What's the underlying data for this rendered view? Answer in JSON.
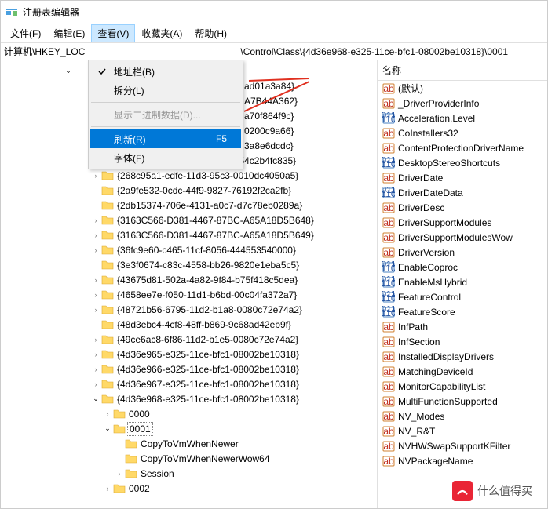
{
  "window": {
    "title": "注册表编辑器"
  },
  "menubar": {
    "file": "文件(F)",
    "edit": "编辑(E)",
    "view": "查看(V)",
    "fav": "收藏夹(A)",
    "help": "帮助(H)"
  },
  "addressbar": {
    "left": "计算机\\HKEY_LOC",
    "right": "\\Control\\Class\\{4d36e968-e325-11ce-bfc1-08002be10318}\\0001"
  },
  "dropdown": {
    "addr": "地址栏(B)",
    "split": "拆分(L)",
    "binary": "显示二进制数据(D)...",
    "refresh": "刷新(R)",
    "refresh_sc": "F5",
    "font": "字体(F)"
  },
  "tree": {
    "middle_peek": [
      "ad01a3a84}",
      "A7B44A362}",
      "a70f864f9c}",
      "0200c9a66}",
      "3a8e6dcdc}"
    ],
    "nodes": [
      {
        "t": "{25dbce51-6c8f-4a72-8a6d-b54c2b4fc835}",
        "ind": 115,
        "arrow": ">"
      },
      {
        "t": "{268c95a1-edfe-11d3-95c3-0010dc4050a5}",
        "ind": 115,
        "arrow": ">"
      },
      {
        "t": "{2a9fe532-0cdc-44f9-9827-76192f2ca2fb}",
        "ind": 115,
        "arrow": ""
      },
      {
        "t": "{2db15374-706e-4131-a0c7-d7c78eb0289a}",
        "ind": 115,
        "arrow": ""
      },
      {
        "t": "{3163C566-D381-4467-87BC-A65A18D5B648}",
        "ind": 115,
        "arrow": ">"
      },
      {
        "t": "{3163C566-D381-4467-87BC-A65A18D5B649}",
        "ind": 115,
        "arrow": ">"
      },
      {
        "t": "{36fc9e60-c465-11cf-8056-444553540000}",
        "ind": 115,
        "arrow": ">"
      },
      {
        "t": "{3e3f0674-c83c-4558-bb26-9820e1eba5c5}",
        "ind": 115,
        "arrow": ""
      },
      {
        "t": "{43675d81-502a-4a82-9f84-b75f418c5dea}",
        "ind": 115,
        "arrow": ">"
      },
      {
        "t": "{4658ee7e-f050-11d1-b6bd-00c04fa372a7}",
        "ind": 115,
        "arrow": ">"
      },
      {
        "t": "{48721b56-6795-11d2-b1a8-0080c72e74a2}",
        "ind": 115,
        "arrow": ">"
      },
      {
        "t": "{48d3ebc4-4cf8-48ff-b869-9c68ad42eb9f}",
        "ind": 115,
        "arrow": ""
      },
      {
        "t": "{49ce6ac8-6f86-11d2-b1e5-0080c72e74a2}",
        "ind": 115,
        "arrow": ">"
      },
      {
        "t": "{4d36e965-e325-11ce-bfc1-08002be10318}",
        "ind": 115,
        "arrow": ">"
      },
      {
        "t": "{4d36e966-e325-11ce-bfc1-08002be10318}",
        "ind": 115,
        "arrow": ">"
      },
      {
        "t": "{4d36e967-e325-11ce-bfc1-08002be10318}",
        "ind": 115,
        "arrow": ">"
      },
      {
        "t": "{4d36e968-e325-11ce-bfc1-08002be10318}",
        "ind": 115,
        "arrow": "v"
      },
      {
        "t": "0000",
        "ind": 130,
        "arrow": ">"
      },
      {
        "t": "0001",
        "ind": 130,
        "arrow": "v",
        "sel": true
      },
      {
        "t": "CopyToVmWhenNewer",
        "ind": 145,
        "arrow": ""
      },
      {
        "t": "CopyToVmWhenNewerWow64",
        "ind": 145,
        "arrow": ""
      },
      {
        "t": "Session",
        "ind": 145,
        "arrow": ">"
      },
      {
        "t": "0002",
        "ind": 130,
        "arrow": ">"
      }
    ]
  },
  "list": {
    "header": "名称",
    "items": [
      {
        "icon": "str",
        "t": "(默认)"
      },
      {
        "icon": "str",
        "t": "_DriverProviderInfo"
      },
      {
        "icon": "bin",
        "t": "Acceleration.Level"
      },
      {
        "icon": "str",
        "t": "CoInstallers32"
      },
      {
        "icon": "str",
        "t": "ContentProtectionDriverName"
      },
      {
        "icon": "bin",
        "t": "DesktopStereoShortcuts"
      },
      {
        "icon": "str",
        "t": "DriverDate"
      },
      {
        "icon": "bin",
        "t": "DriverDateData"
      },
      {
        "icon": "str",
        "t": "DriverDesc"
      },
      {
        "icon": "str",
        "t": "DriverSupportModules"
      },
      {
        "icon": "str",
        "t": "DriverSupportModulesWow"
      },
      {
        "icon": "str",
        "t": "DriverVersion"
      },
      {
        "icon": "bin",
        "t": "EnableCoproc"
      },
      {
        "icon": "bin",
        "t": "EnableMsHybrid"
      },
      {
        "icon": "bin",
        "t": "FeatureControl"
      },
      {
        "icon": "bin",
        "t": "FeatureScore"
      },
      {
        "icon": "str",
        "t": "InfPath"
      },
      {
        "icon": "str",
        "t": "InfSection"
      },
      {
        "icon": "str",
        "t": "InstalledDisplayDrivers"
      },
      {
        "icon": "str",
        "t": "MatchingDeviceId"
      },
      {
        "icon": "str",
        "t": "MonitorCapabilityList"
      },
      {
        "icon": "str",
        "t": "MultiFunctionSupported"
      },
      {
        "icon": "str",
        "t": "NV_Modes"
      },
      {
        "icon": "str",
        "t": "NV_R&T"
      },
      {
        "icon": "str",
        "t": "NVHWSwapSupportKFilter"
      },
      {
        "icon": "str",
        "t": "NVPackageName"
      }
    ]
  },
  "watermark": {
    "text": "什么值得买"
  }
}
